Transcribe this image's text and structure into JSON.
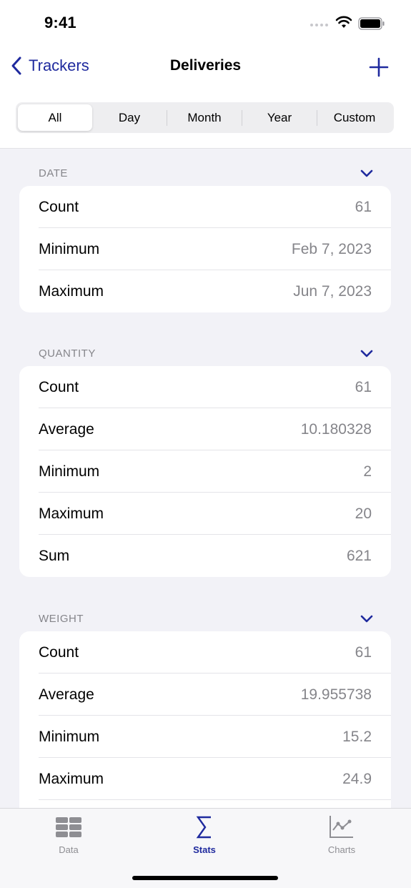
{
  "status_bar": {
    "time": "9:41"
  },
  "nav": {
    "back_label": "Trackers",
    "title": "Deliveries",
    "add_icon": "plus-icon"
  },
  "segments": [
    {
      "label": "All",
      "selected": true
    },
    {
      "label": "Day",
      "selected": false
    },
    {
      "label": "Month",
      "selected": false
    },
    {
      "label": "Year",
      "selected": false
    },
    {
      "label": "Custom",
      "selected": false
    }
  ],
  "sections": [
    {
      "title": "DATE",
      "rows": [
        {
          "label": "Count",
          "value": "61"
        },
        {
          "label": "Minimum",
          "value": "Feb 7, 2023"
        },
        {
          "label": "Maximum",
          "value": "Jun 7, 2023"
        }
      ]
    },
    {
      "title": "QUANTITY",
      "rows": [
        {
          "label": "Count",
          "value": "61"
        },
        {
          "label": "Average",
          "value": "10.180328"
        },
        {
          "label": "Minimum",
          "value": "2"
        },
        {
          "label": "Maximum",
          "value": "20"
        },
        {
          "label": "Sum",
          "value": "621"
        }
      ]
    },
    {
      "title": "WEIGHT",
      "rows": [
        {
          "label": "Count",
          "value": "61"
        },
        {
          "label": "Average",
          "value": "19.955738"
        },
        {
          "label": "Minimum",
          "value": "15.2"
        },
        {
          "label": "Maximum",
          "value": "24.9"
        }
      ]
    }
  ],
  "tab_bar": {
    "tabs": [
      {
        "label": "Data",
        "icon": "table-icon",
        "active": false
      },
      {
        "label": "Stats",
        "icon": "sigma-icon",
        "active": true
      },
      {
        "label": "Charts",
        "icon": "line-chart-icon",
        "active": false
      }
    ]
  },
  "colors": {
    "accent": "#1f2a9e",
    "background": "#f2f2f7",
    "secondary_text": "#85858a"
  }
}
